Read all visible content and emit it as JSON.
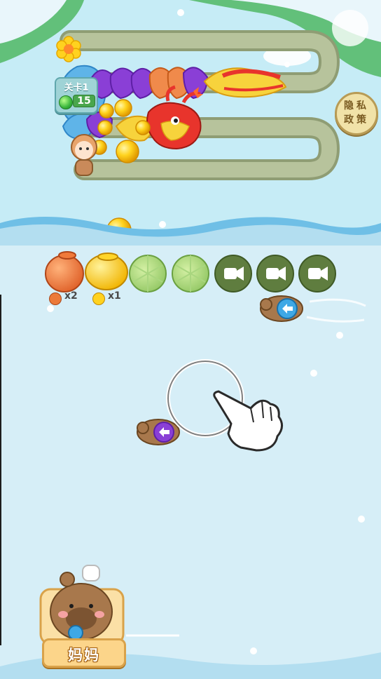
{
  "hud": {
    "level_label": "关卡1",
    "gem_count": "15",
    "privacy_line1": "隐私",
    "privacy_line2": "政策"
  },
  "inventory": {
    "slots": [
      {
        "type": "orange-pot",
        "icon": "orange-pot-icon"
      },
      {
        "type": "gold-pot",
        "icon": "gold-pot-icon"
      },
      {
        "type": "lily-pad",
        "icon": "lily-pad-icon"
      },
      {
        "type": "lily-pad",
        "icon": "lily-pad-icon"
      },
      {
        "type": "video-locked",
        "icon": "video-camera-icon"
      },
      {
        "type": "video-locked",
        "icon": "video-camera-icon"
      },
      {
        "type": "video-locked",
        "icon": "video-camera-icon"
      }
    ],
    "orange_multiplier": "x2",
    "gold_multiplier": "x1"
  },
  "character": {
    "name": "妈妈"
  },
  "colors": {
    "sky": "#d6eef7",
    "water": "#b8e3f2",
    "grass": "#62c07a",
    "track": "#a9b68f",
    "dragon_red": "#e8342c",
    "purple_scale": "#8a3fd6",
    "orange_scale": "#f08a4b",
    "gold": "#f6c21a"
  }
}
